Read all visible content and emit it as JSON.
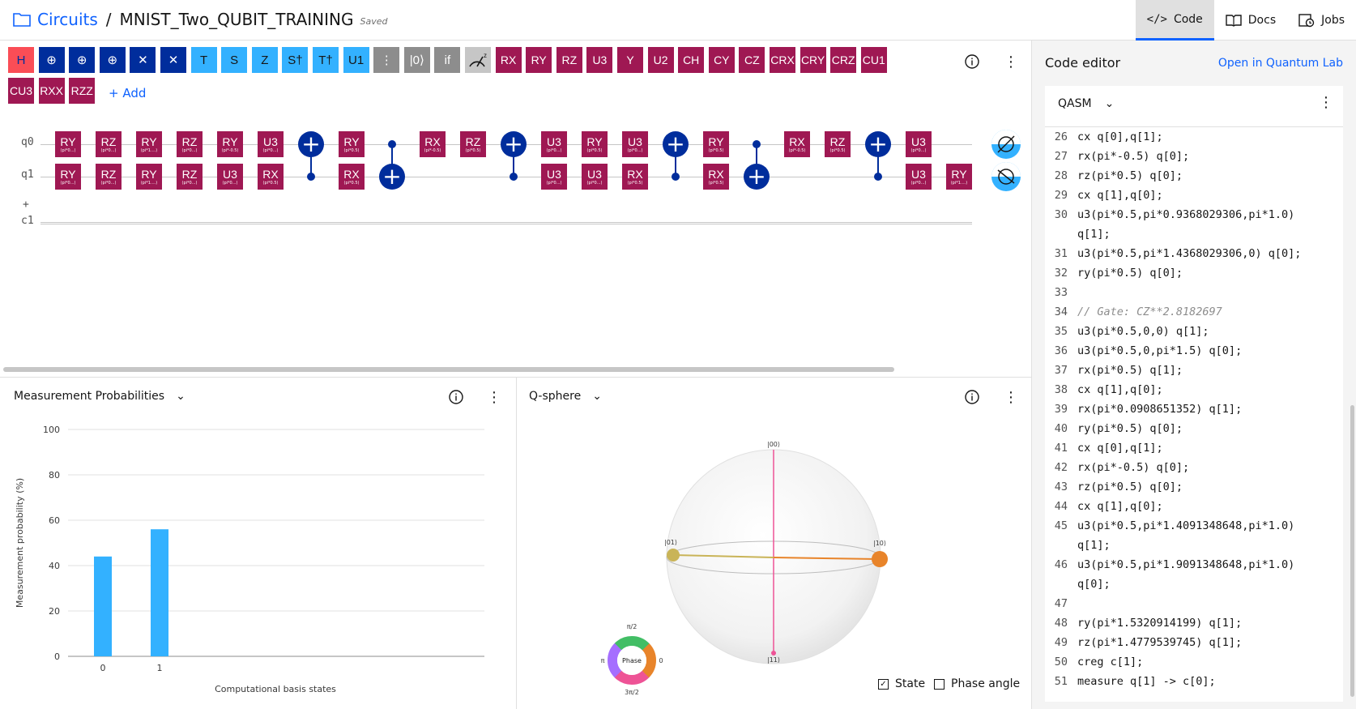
{
  "header": {
    "breadcrumb_root": "Circuits",
    "separator": "/",
    "title": "MNIST_Two_QUBIT_TRAINING",
    "status": "Saved"
  },
  "nav": {
    "tabs": [
      {
        "label": "Code",
        "icon": "code-icon",
        "active": true
      },
      {
        "label": "Docs",
        "icon": "docs-icon"
      },
      {
        "label": "Jobs",
        "icon": "jobs-icon"
      }
    ]
  },
  "toolbar": {
    "gates": [
      "H",
      "⊕",
      "⊕",
      "⊕",
      "✕",
      "✕",
      "T",
      "S",
      "Z",
      "S†",
      "T†",
      "U1",
      "⋮",
      "|0⟩",
      "if",
      "",
      "RX",
      "RY",
      "RZ",
      "U3",
      "Y",
      "U2",
      "CH",
      "CY",
      "CZ",
      "CRX",
      "CRY",
      "CRZ",
      "CU1",
      "CU3",
      "RXX",
      "RZZ"
    ],
    "add_label": "+ Add"
  },
  "circuit": {
    "qubits": [
      "q0",
      "q1"
    ],
    "classical": "c1",
    "q0_gates": [
      [
        "RY",
        "(pi*0...)"
      ],
      [
        "RZ",
        "(pi*0...)"
      ],
      [
        "RY",
        "(pi*1....)"
      ],
      [
        "RZ",
        "(pi*0...)"
      ],
      [
        "RY",
        "(pi*-0.5)"
      ],
      [
        "U3",
        "(pi*0...)"
      ],
      [
        "RY",
        "(pi*0.5)"
      ],
      [
        "RX",
        "(pi*-0.5)"
      ],
      [
        "RZ",
        "(pi*0.5)"
      ],
      [
        "U3",
        "(pi*0...)"
      ],
      [
        "RY",
        "(pi*0.5)"
      ],
      [
        "U3",
        "(pi*0...)"
      ],
      [
        "RY",
        "(pi*0.5)"
      ],
      [
        "RX",
        "(pi*-0.5)"
      ],
      [
        "RZ",
        "(pi*0.5)"
      ],
      [
        "U3",
        "(pi*0...)"
      ]
    ],
    "q1_gates": [
      [
        "RY",
        "(pi*0...)"
      ],
      [
        "RZ",
        "(pi*0...)"
      ],
      [
        "RY",
        "(pi*1....)"
      ],
      [
        "RZ",
        "(pi*0...)"
      ],
      [
        "U3",
        "(pi*0...)"
      ],
      [
        "RX",
        "(pi*0.5)"
      ],
      [
        "RX",
        "(pi*0.5)"
      ],
      [
        "U3",
        "(pi*0...)"
      ],
      [
        "U3",
        "(pi*0...)"
      ],
      [
        "RX",
        "(pi*0.5)"
      ],
      [
        "RX",
        "(pi*0.5)"
      ],
      [
        "U3",
        "(pi*0...)"
      ],
      [
        "RY",
        "(pi*1....)"
      ]
    ]
  },
  "measurement_panel": {
    "title": "Measurement Probabilities",
    "chart_data": {
      "type": "bar",
      "categories": [
        "0",
        "1"
      ],
      "values": [
        44,
        56
      ],
      "ylabel": "Measurement probability (%)",
      "xlabel": "Computational basis states",
      "ylim": [
        0,
        100
      ],
      "yticks": [
        "0",
        "20",
        "40",
        "60",
        "80",
        "100"
      ],
      "color": "#33b1ff"
    }
  },
  "qsphere_panel": {
    "title": "Q-sphere",
    "states": [
      "|00⟩",
      "|01⟩",
      "|10⟩",
      "|11⟩"
    ],
    "phase_labels": {
      "top": "π/2",
      "left": "π",
      "right": "0",
      "bottom": "3π/2",
      "center": "Phase"
    },
    "state_label": "State",
    "state_checked": true,
    "phase_angle_label": "Phase angle",
    "phase_angle_checked": false
  },
  "editor": {
    "title": "Code editor",
    "open_link": "Open in Quantum Lab",
    "language": "QASM",
    "lines": [
      [
        "26",
        "cx q[0],q[1];"
      ],
      [
        "27",
        "rx(pi*-0.5) q[0];"
      ],
      [
        "28",
        "rz(pi*0.5) q[0];"
      ],
      [
        "29",
        "cx q[1],q[0];"
      ],
      [
        "30",
        "u3(pi*0.5,pi*0.9368029306,pi*1.0)"
      ],
      [
        "",
        "q[1];"
      ],
      [
        "31",
        "u3(pi*0.5,pi*1.4368029306,0) q[0];"
      ],
      [
        "32",
        "ry(pi*0.5) q[0];"
      ],
      [
        "33",
        ""
      ],
      [
        "34",
        "// Gate: CZ**2.8182697"
      ],
      [
        "35",
        "u3(pi*0.5,0,0) q[1];"
      ],
      [
        "36",
        "u3(pi*0.5,0,pi*1.5) q[0];"
      ],
      [
        "37",
        "rx(pi*0.5) q[1];"
      ],
      [
        "38",
        "cx q[1],q[0];"
      ],
      [
        "39",
        "rx(pi*0.0908651352) q[1];"
      ],
      [
        "40",
        "ry(pi*0.5) q[0];"
      ],
      [
        "41",
        "cx q[0],q[1];"
      ],
      [
        "42",
        "rx(pi*-0.5) q[0];"
      ],
      [
        "43",
        "rz(pi*0.5) q[0];"
      ],
      [
        "44",
        "cx q[1],q[0];"
      ],
      [
        "45",
        "u3(pi*0.5,pi*1.4091348648,pi*1.0)"
      ],
      [
        "",
        "q[1];"
      ],
      [
        "46",
        "u3(pi*0.5,pi*1.9091348648,pi*1.0)"
      ],
      [
        "",
        "q[0];"
      ],
      [
        "47",
        ""
      ],
      [
        "48",
        "ry(pi*1.5320914199) q[1];"
      ],
      [
        "49",
        "rz(pi*1.4779539745) q[1];"
      ],
      [
        "50",
        "creg c[1];"
      ],
      [
        "51",
        "measure q[1] -> c[0];"
      ]
    ]
  }
}
